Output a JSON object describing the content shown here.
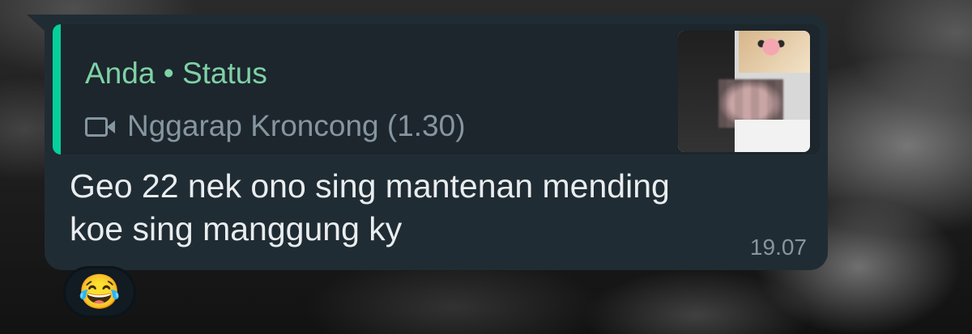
{
  "message": {
    "quoted": {
      "author": "Anda",
      "separator": "•",
      "type": "Status",
      "media_icon": "video-camera-icon",
      "media_caption": "Nggarap Kroncong (1.30)"
    },
    "text": "Geo 22 nek ono sing mantenan mending\nkoe sing manggung ky",
    "time": "19.07",
    "reaction": "😂"
  },
  "colors": {
    "bubble": "#202c33",
    "quote_accent": "#06cf9c",
    "quote_title": "#7fd1a6",
    "muted": "#8696a0",
    "text": "#e9edef"
  }
}
